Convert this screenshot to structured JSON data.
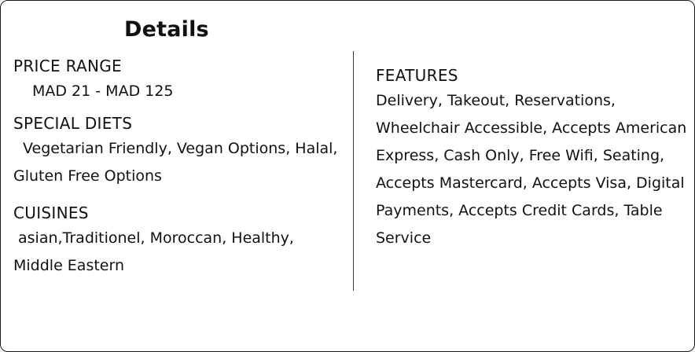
{
  "details": {
    "title": "Details",
    "price_range": {
      "label": "PRICE RANGE",
      "value": "MAD 21 - MAD 125"
    },
    "special_diets": {
      "label": "SPECIAL DIETS",
      "value": "Vegetarian Friendly, Vegan Options, Halal, Gluten Free Options"
    },
    "cuisines": {
      "label": "CUISINES",
      "value": "asian,Traditionel, Moroccan, Healthy, Middle Eastern"
    },
    "features": {
      "label": "FEATURES",
      "value": "Delivery, Takeout, Reservations, Wheelchair Accessible, Accepts American Express, Cash Only, Free Wifi, Seating, Accepts Mastercard, Accepts Visa, Digital Payments, Accepts Credit Cards, Table Service"
    }
  }
}
